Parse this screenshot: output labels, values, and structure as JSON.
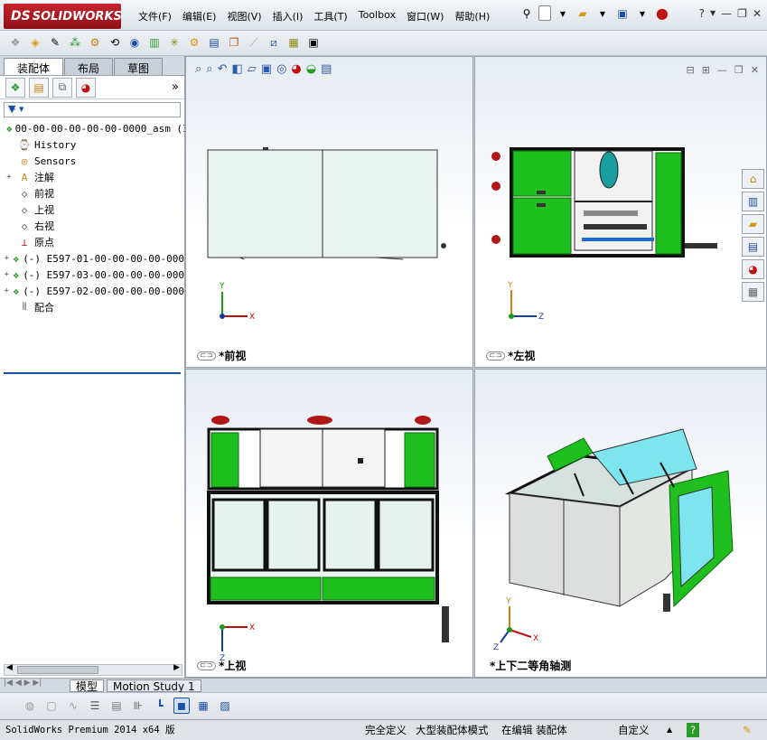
{
  "app": {
    "logo": "SOLIDWORKS",
    "logo_prefix": "DS"
  },
  "menus": [
    "文件(F)",
    "编辑(E)",
    "视图(V)",
    "插入(I)",
    "工具(T)",
    "Toolbox",
    "窗口(W)",
    "帮助(H)"
  ],
  "left_panel": {
    "tabs": [
      "装配体",
      "布局",
      "草图"
    ],
    "filter_icon": "filter-icon",
    "tree": [
      {
        "label": "00-00-00-00-00-00-0000_asm  (I",
        "icon": "assembly-icon",
        "expand": ""
      },
      {
        "label": "History",
        "icon": "history-icon",
        "expand": ""
      },
      {
        "label": "Sensors",
        "icon": "sensors-icon",
        "expand": ""
      },
      {
        "label": "注解",
        "icon": "annotation-icon",
        "expand": "+"
      },
      {
        "label": "前视",
        "icon": "plane-icon",
        "expand": ""
      },
      {
        "label": "上视",
        "icon": "plane-icon",
        "expand": ""
      },
      {
        "label": "右视",
        "icon": "plane-icon",
        "expand": ""
      },
      {
        "label": "原点",
        "icon": "origin-icon",
        "expand": ""
      },
      {
        "label": "(-) E597-01-00-00-00-00-000",
        "icon": "subassembly-icon",
        "expand": "+"
      },
      {
        "label": "(-) E597-03-00-00-00-00-000",
        "icon": "subassembly-icon",
        "expand": "+"
      },
      {
        "label": "(-) E597-02-00-00-00-00-000",
        "icon": "subassembly-icon",
        "expand": "+"
      },
      {
        "label": "配合",
        "icon": "mates-icon",
        "expand": ""
      }
    ]
  },
  "viewports": {
    "front": "*前视",
    "left": "*左视",
    "top": "*上视",
    "iso": "*上下二等角轴测"
  },
  "axes": {
    "x": "X",
    "y": "Y",
    "z": "Z"
  },
  "bottom_tabs": [
    "模型",
    "Motion Study 1"
  ],
  "status": {
    "product": "SolidWorks Premium 2014 x64 版",
    "defined": "完全定义",
    "mode": "大型装配体模式",
    "editing": "在编辑 装配体",
    "units": "自定义"
  },
  "colors": {
    "green": "#1fbf1f",
    "dark_green": "#0e8a0e",
    "panel_glass": "#e8f2ee",
    "frame": "#1a1a1a",
    "cyan": "#7ee4f0",
    "red_part": "#b01818"
  }
}
